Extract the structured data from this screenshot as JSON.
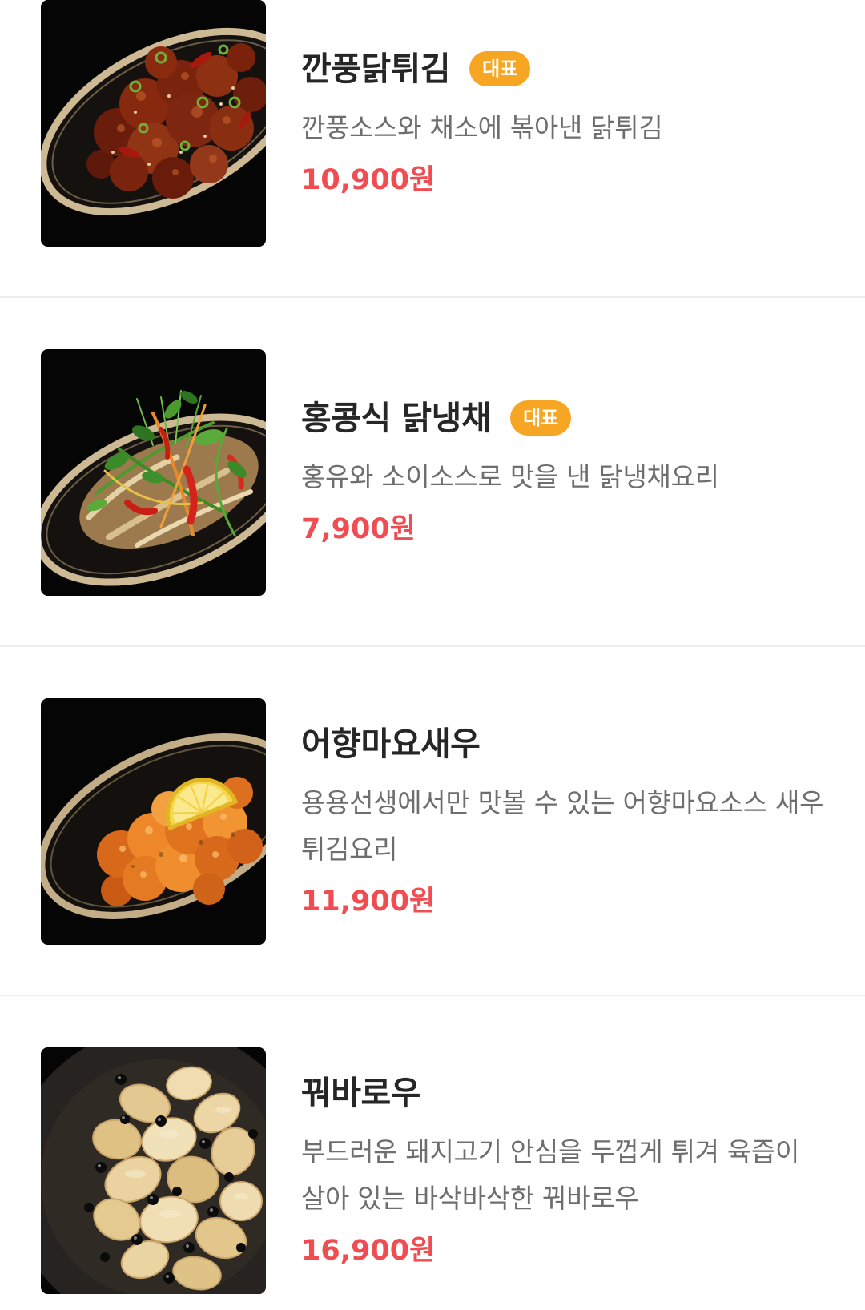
{
  "colors": {
    "price": "#EF4D52",
    "badge": "#F6A623",
    "title": "#262626",
    "description": "#6E6E6E"
  },
  "items": [
    {
      "name": "깐풍닭튀김",
      "badge": "대표",
      "description": "깐풍소스와 채소에 볶아낸 닭튀김",
      "price": "10,900원"
    },
    {
      "name": "홍콩식 닭냉채",
      "badge": "대표",
      "description": "홍유와 소이소스로 맛을 낸 닭냉채요리",
      "price": "7,900원"
    },
    {
      "name": "어향마요새우",
      "description": "용용선생에서만 맛볼 수 있는 어향마요소스 새우튀김요리",
      "price": "11,900원"
    },
    {
      "name": "꿔바로우",
      "description": "부드러운 돼지고기 안심을 두껍게 튀겨 육즙이 살아 있는 바삭바삭한 꿔바로우",
      "price": "16,900원"
    }
  ]
}
